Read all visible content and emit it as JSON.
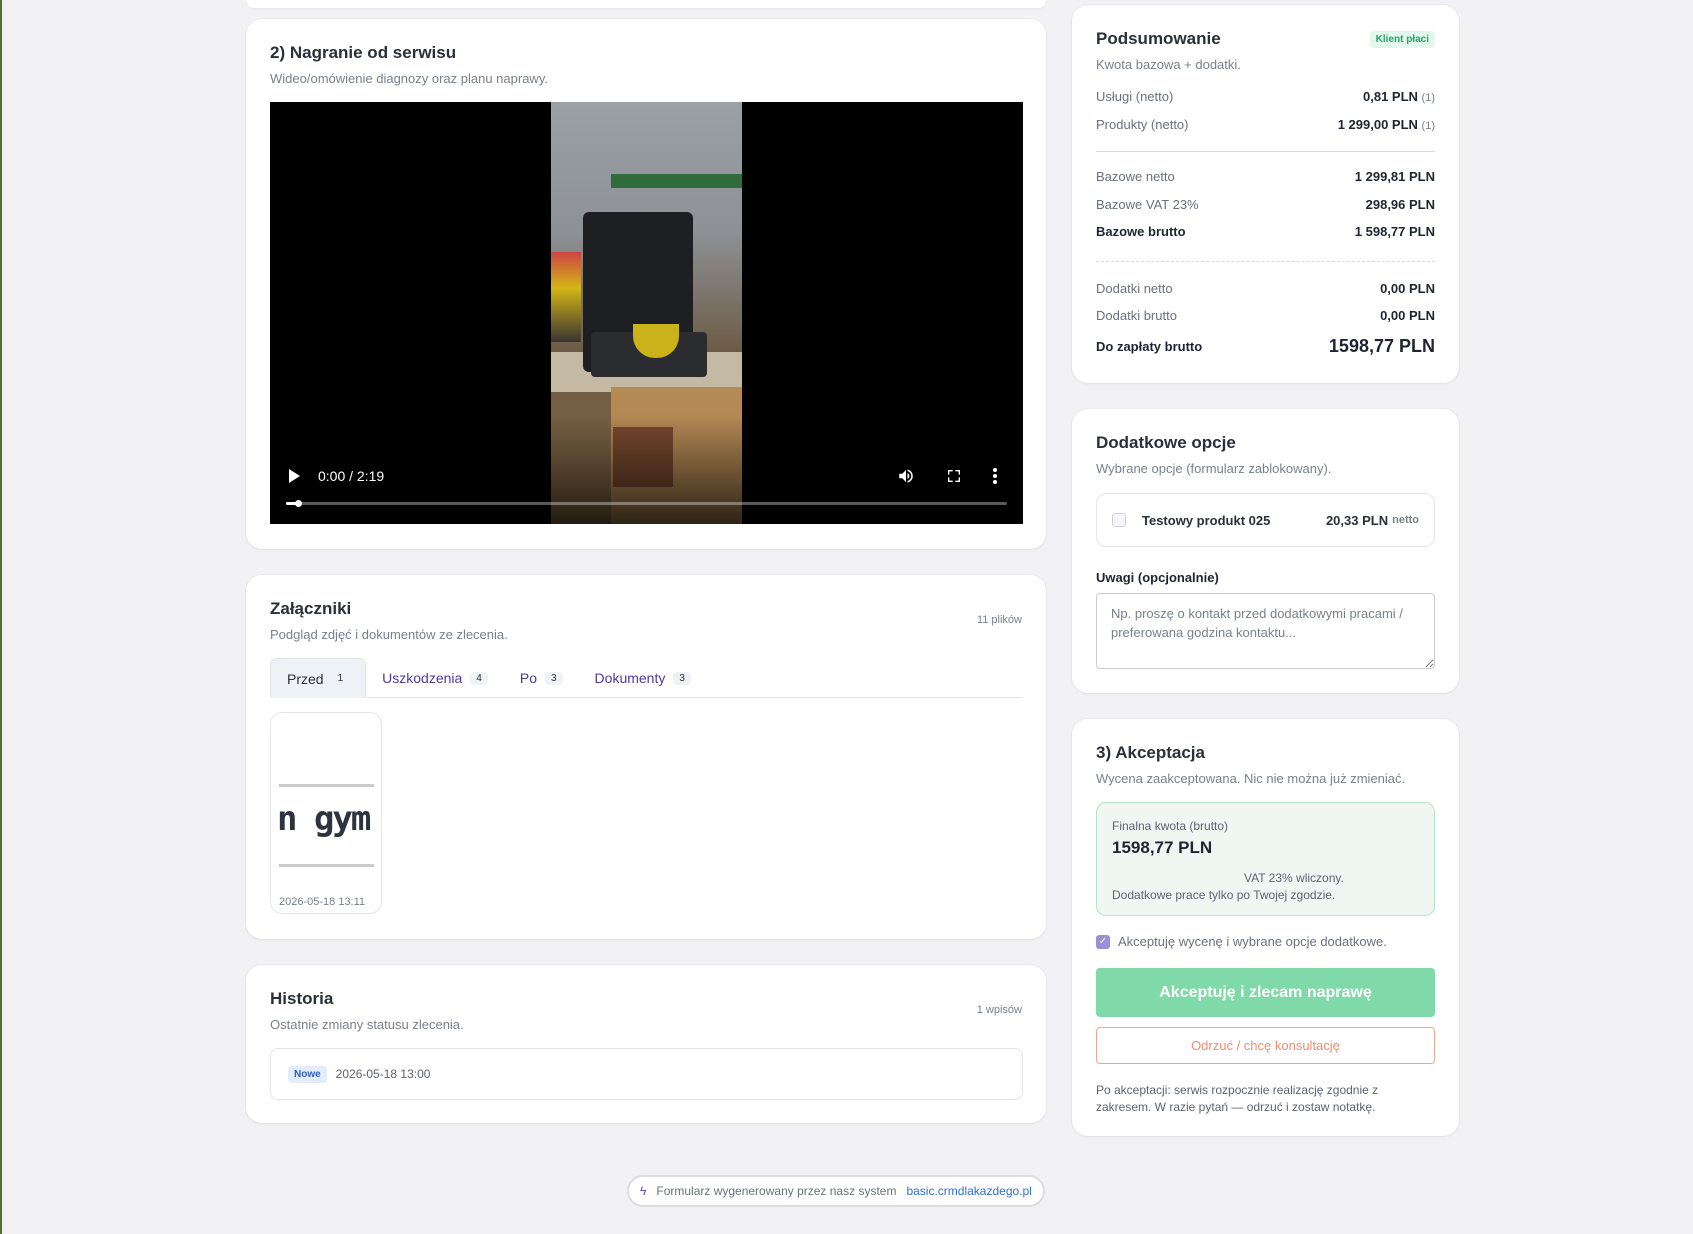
{
  "video_section": {
    "title": "2) Nagranie od serwisu",
    "subtitle": "Wideo/omówienie diagnozy oraz planu naprawy.",
    "time": "0:00 / 2:19",
    "progress_fraction": 0.0
  },
  "attachments": {
    "title": "Załączniki",
    "subtitle": "Podgląd zdjęć i dokumentów ze zlecenia.",
    "count_label": "11 plików",
    "tabs": [
      {
        "label": "Przed",
        "count": "1",
        "active": true
      },
      {
        "label": "Uszkodzenia",
        "count": "4",
        "active": false
      },
      {
        "label": "Po",
        "count": "3",
        "active": false
      },
      {
        "label": "Dokumenty",
        "count": "3",
        "active": false
      }
    ],
    "thumbnail": {
      "image_text": "n gym",
      "date": "2026-05-18 13:11"
    }
  },
  "history": {
    "title": "Historia",
    "subtitle": "Ostatnie zmiany statusu zlecenia.",
    "count_label": "1 wpisów",
    "entries": [
      {
        "status": "Nowe",
        "date": "2026-05-18 13:00"
      }
    ]
  },
  "summary": {
    "title": "Podsumowanie",
    "badge": "Klient płaci",
    "subtitle": "Kwota bazowa + dodatki.",
    "rows": [
      {
        "label": "Usługi (netto)",
        "value": "0,81 PLN",
        "extra": "(1)"
      },
      {
        "label": "Produkty (netto)",
        "value": "1 299,00 PLN",
        "extra": "(1)"
      },
      {
        "label": "Bazowe netto",
        "value": "1 299,81 PLN"
      },
      {
        "label": "Bazowe VAT 23%",
        "value": "298,96 PLN"
      },
      {
        "label": "Bazowe brutto",
        "value": "1 598,77 PLN"
      },
      {
        "label": "Dodatki netto",
        "value": "0,00 PLN"
      },
      {
        "label": "Dodatki brutto",
        "value": "0,00 PLN"
      },
      {
        "label": "Do zapłaty brutto",
        "value": "1598,77 PLN"
      }
    ]
  },
  "options": {
    "title": "Dodatkowe opcje",
    "subtitle": "Wybrane opcje (formularz zablokowany).",
    "items": [
      {
        "name": "Testowy produkt 025",
        "price": "20,33 PLN",
        "unit": "netto",
        "checked": false
      }
    ],
    "notes_label": "Uwagi (opcjonalnie)",
    "notes_placeholder": "Np. proszę o kontakt przed dodatkowymi pracami / preferowana godzina kontaktu..."
  },
  "acceptance": {
    "title": "3) Akceptacja",
    "subtitle": "Wycena zaakceptowana. Nic nie można już zmieniać.",
    "final_label": "Finalna kwota (brutto)",
    "final_amount": "1598,77 PLN",
    "vat_note": "VAT 23% wliczony.",
    "extra_note": "Dodatkowe prace tylko po Twojej zgodzie.",
    "checkbox_label": "Akceptuję wycenę i wybrane opcje dodatkowe.",
    "checkbox_checked": true,
    "accept_button": "Akceptuję i zlecam naprawę",
    "reject_button": "Odrzuć / chcę konsultację",
    "after_note": "Po akceptacji: serwis rozpocznie realizację zgodnie z zakresem. W razie pytań — odrzuć i zostaw notatkę."
  },
  "footer": {
    "text": "Formularz wygenerowany przez nasz system",
    "link": "basic.crmdlakazdego.pl",
    "icon": "bolt-icon"
  },
  "colors": {
    "accent": "#4b3aa6",
    "success": "#7fd9a9",
    "danger": "#f08c70",
    "link": "#2f6fd6"
  }
}
